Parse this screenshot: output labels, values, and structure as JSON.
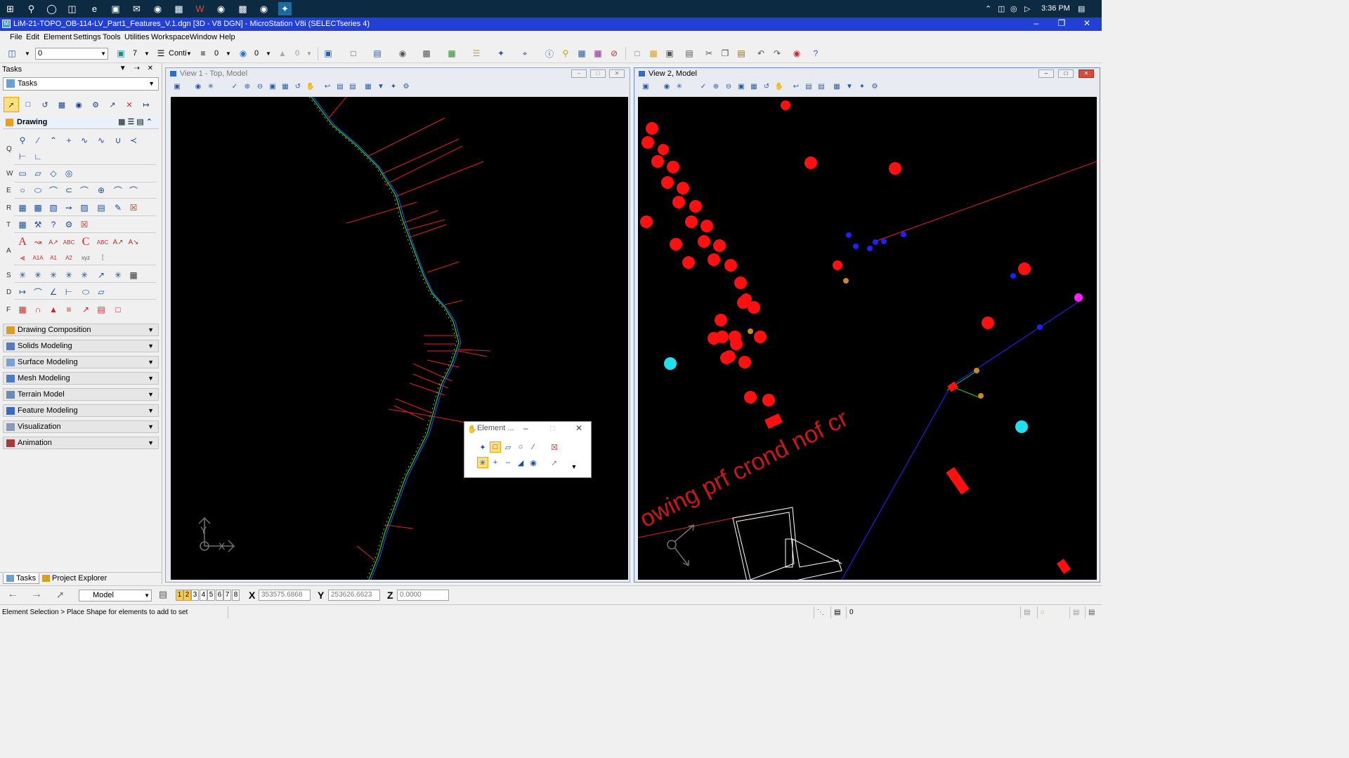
{
  "taskbar": {
    "icons": [
      "windows-start",
      "search",
      "cortana",
      "task-view",
      "edge",
      "store",
      "mail",
      "chrome",
      "file-explorer",
      "office",
      "chrome-2",
      "app-blue",
      "recorder",
      "microstation"
    ],
    "time": "3:36 PM"
  },
  "window": {
    "title": "LiM-21-TOPO_OB-114-LV_Part1_Features_V.1.dgn [3D - V8 DGN] - MicroStation V8i (SELECTseries 4)"
  },
  "menu": {
    "items": [
      "File",
      "Edit",
      "Element",
      "Settings",
      "Tools",
      "Utilities",
      "Workspace",
      "Window",
      "Help"
    ]
  },
  "toolbar": {
    "active_level": "0",
    "color": "7",
    "line_style": "Conti",
    "weight": "0",
    "transparency": "0",
    "priority": "0"
  },
  "tasks_panel": {
    "header": "Tasks",
    "combo_value": "Tasks",
    "drawing_title": "Drawing",
    "row_letters": [
      "Q",
      "W",
      "E",
      "R",
      "T",
      "A",
      "S",
      "D",
      "F"
    ],
    "sections": [
      "Drawing Composition",
      "Solids Modeling",
      "Surface Modeling",
      "Mesh Modeling",
      "Terrain Model",
      "Feature Modeling",
      "Visualization",
      "Animation"
    ],
    "tabs": [
      "Tasks",
      "Project Explorer"
    ]
  },
  "view1": {
    "title": "View 1 - Top, Model"
  },
  "view2": {
    "title": "View 2, Model"
  },
  "element_dialog": {
    "title": "Element ..."
  },
  "coords": {
    "model": "Model",
    "x_label": "X",
    "x_value": "353575.6868",
    "y_label": "Y",
    "y_value": "253626.6623",
    "z_label": "Z",
    "z_value": "0.0000",
    "view_numbers": [
      "1",
      "2",
      "3",
      "4",
      "5",
      "6",
      "7",
      "8"
    ]
  },
  "status": {
    "message": "Element Selection > Place Shape for elements to add to set",
    "level_value": "0"
  },
  "canvas_text": {
    "road_label": "owing prf crond nof cr"
  }
}
